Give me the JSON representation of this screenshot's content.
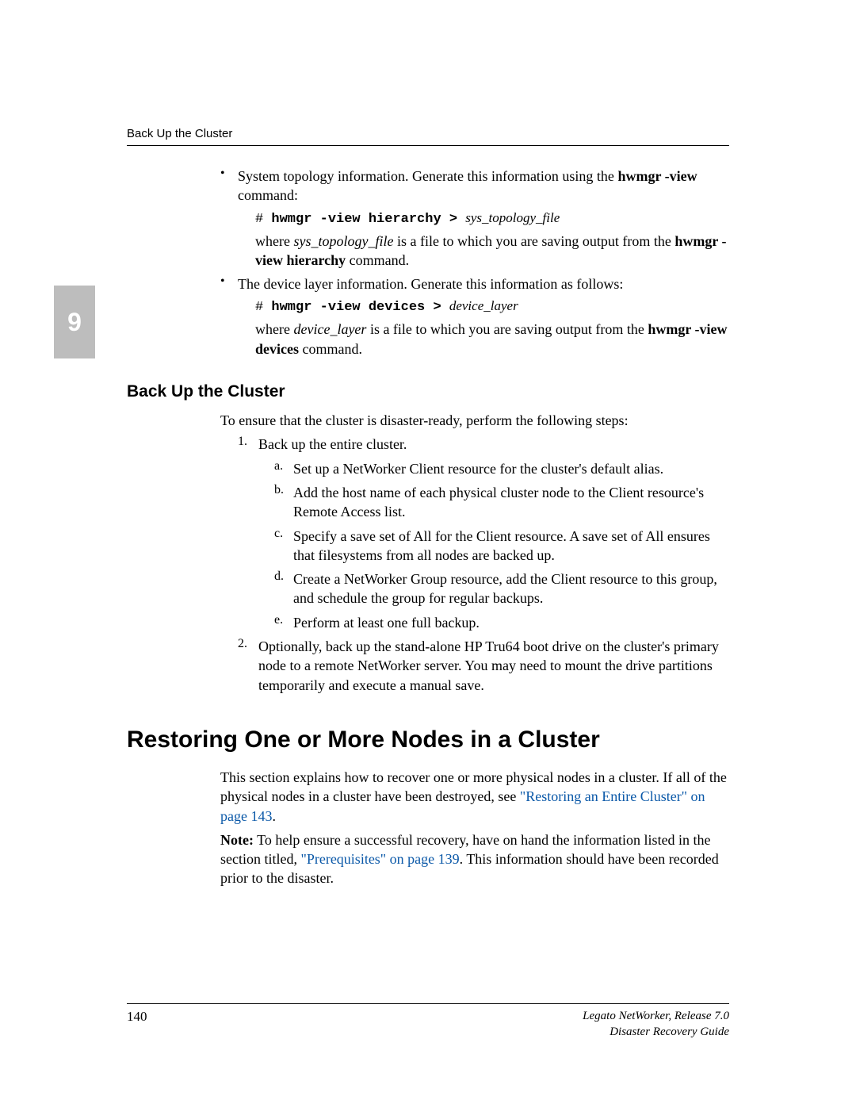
{
  "header": {
    "running_title": "Back Up the Cluster"
  },
  "chapter": {
    "number": "9"
  },
  "top_block": {
    "b1": {
      "lead": "System topology information. Generate this information using the ",
      "cmd_bold": "hwmgr -view",
      "lead_tail": " command:",
      "code_prefix": "# ",
      "code_bold": "hwmgr -view hierarchy > ",
      "code_ital": "sys_topology_file",
      "where_a": "where ",
      "where_ital": "sys_topology_file",
      "where_b": " is a file to which you are saving output from the ",
      "where_bold": "hwmgr -view hierarchy",
      "where_tail": " command."
    },
    "b2": {
      "lead": "The device layer information. Generate this information as follows:",
      "code_prefix": "# ",
      "code_bold": "hwmgr -view devices > ",
      "code_ital": "device_layer",
      "where_a": "where ",
      "where_ital": "device_layer",
      "where_b": " is a file to which you are saving output from the ",
      "where_bold": "hwmgr -view devices",
      "where_tail": " command."
    }
  },
  "section_backup": {
    "title": "Back Up the Cluster",
    "intro": "To ensure that the cluster is disaster-ready, perform the following steps:",
    "steps": {
      "n1": "1.",
      "s1": "Back up the entire cluster.",
      "a": "Set up a NetWorker Client resource for the cluster's default alias.",
      "b": "Add the host name of each physical cluster node to the Client resource's Remote Access list.",
      "c": "Specify a save set of All for the Client resource. A save set of All ensures that filesystems from all nodes are backed up.",
      "d": "Create a NetWorker Group resource, add the Client resource to this group, and schedule the group for regular backups.",
      "e": "Perform at least one full backup.",
      "la": "a.",
      "lb": "b.",
      "lc": "c.",
      "ld": "d.",
      "le": "e.",
      "n2": "2.",
      "s2": "Optionally, back up the stand-alone HP Tru64 boot drive on the cluster's primary node to a remote NetWorker server. You may need to mount the drive partitions temporarily and execute a manual save."
    }
  },
  "section_restore": {
    "title": "Restoring One or More Nodes in a Cluster",
    "p1a": "This section explains how to recover one or more physical nodes in a cluster. If all of the physical nodes in a cluster have been destroyed, see ",
    "link1": "\"Restoring an Entire Cluster\" on page 143",
    "p1b": ".",
    "note_label": "Note:",
    "note_a": " To help ensure a successful recovery, have on hand the information listed in the section titled, ",
    "link2": "\"Prerequisites\" on page 139",
    "note_b": ". This information should have been recorded prior to the disaster."
  },
  "footer": {
    "page": "140",
    "line1": "Legato NetWorker, Release 7.0",
    "line2": "Disaster Recovery Guide"
  }
}
